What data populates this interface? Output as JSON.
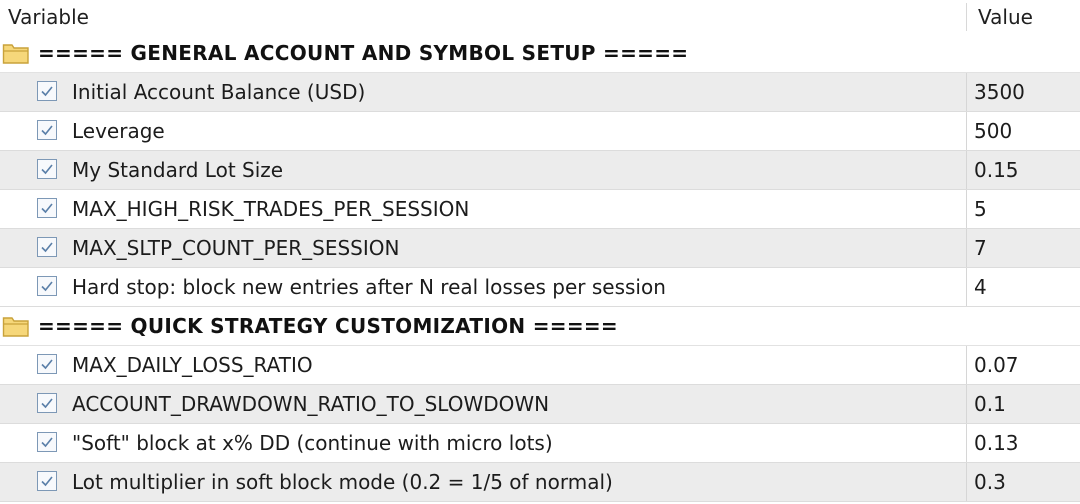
{
  "header": {
    "variable_label": "Variable",
    "value_label": "Value"
  },
  "groups": [
    {
      "title": "===== GENERAL ACCOUNT AND SYMBOL SETUP =====",
      "icon": "folder-icon",
      "rows": [
        {
          "label": "Initial Account Balance (USD)",
          "value": "3500",
          "checked": true
        },
        {
          "label": "Leverage",
          "value": "500",
          "checked": true
        },
        {
          "label": "My Standard Lot Size",
          "value": "0.15",
          "checked": true
        },
        {
          "label": "MAX_HIGH_RISK_TRADES_PER_SESSION",
          "value": "5",
          "checked": true
        },
        {
          "label": "MAX_SLTP_COUNT_PER_SESSION",
          "value": "7",
          "checked": true
        },
        {
          "label": "Hard stop: block new entries after N real losses per session",
          "value": "4",
          "checked": true
        }
      ]
    },
    {
      "title": "===== QUICK STRATEGY CUSTOMIZATION =====",
      "icon": "folder-icon",
      "rows": [
        {
          "label": "MAX_DAILY_LOSS_RATIO",
          "value": "0.07",
          "checked": true
        },
        {
          "label": "ACCOUNT_DRAWDOWN_RATIO_TO_SLOWDOWN",
          "value": "0.1",
          "checked": true
        },
        {
          "label": "\"Soft\" block at x% DD (continue with micro lots)",
          "value": "0.13",
          "checked": true
        },
        {
          "label": "Lot multiplier in soft block mode (0.2 = 1/5 of normal)",
          "value": "0.3",
          "checked": true
        }
      ]
    }
  ],
  "colors": {
    "row_alt": "#ececec",
    "row_white": "#ffffff",
    "checkbox_border": "#7d98b6",
    "checkmark": "#5a7fa8",
    "folder_fill": "#f6d77a",
    "folder_stroke": "#c9a23a"
  }
}
